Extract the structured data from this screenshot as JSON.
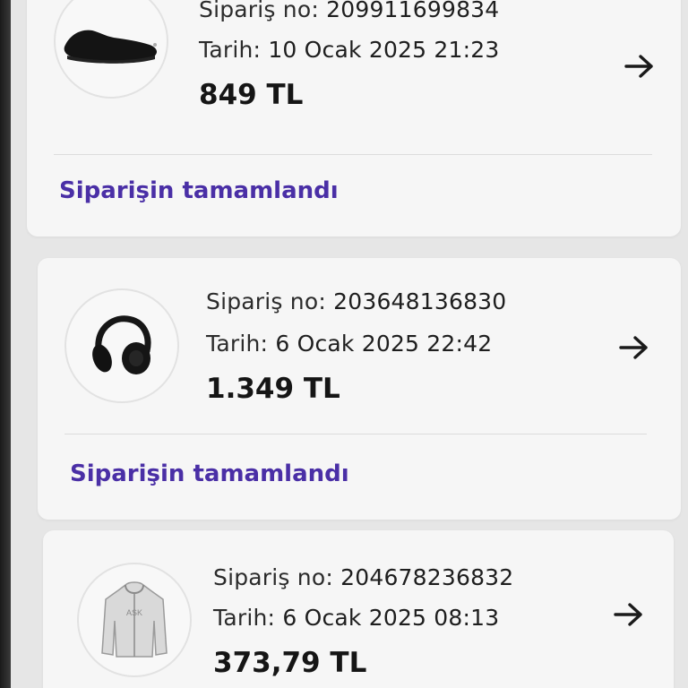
{
  "orders": [
    {
      "order_no_label": "Sipariş no:",
      "order_no": "209911699834",
      "date_label": "Tarih:",
      "date": "10 Ocak 2025 21:23",
      "price": "849 TL",
      "status": "Siparişin tamamlandı",
      "product_icon": "sneaker-icon"
    },
    {
      "order_no_label": "Sipariş no:",
      "order_no": "203648136830",
      "date_label": "Tarih:",
      "date": "6 Ocak 2025 22:42",
      "price": "1.349 TL",
      "status": "Siparişin tamamlandı",
      "product_icon": "headphones-icon"
    },
    {
      "order_no_label": "Sipariş no:",
      "order_no": "204678236832",
      "date_label": "Tarih:",
      "date": "6 Ocak 2025 08:13",
      "price": "373,79 TL",
      "product_icon": "hoodie-icon"
    }
  ],
  "colors": {
    "status": "#4a2fa6",
    "card_bg": "#f6f6f6",
    "page_bg": "#e6e6e6"
  },
  "icons": {
    "arrow": "arrow-right-icon"
  }
}
